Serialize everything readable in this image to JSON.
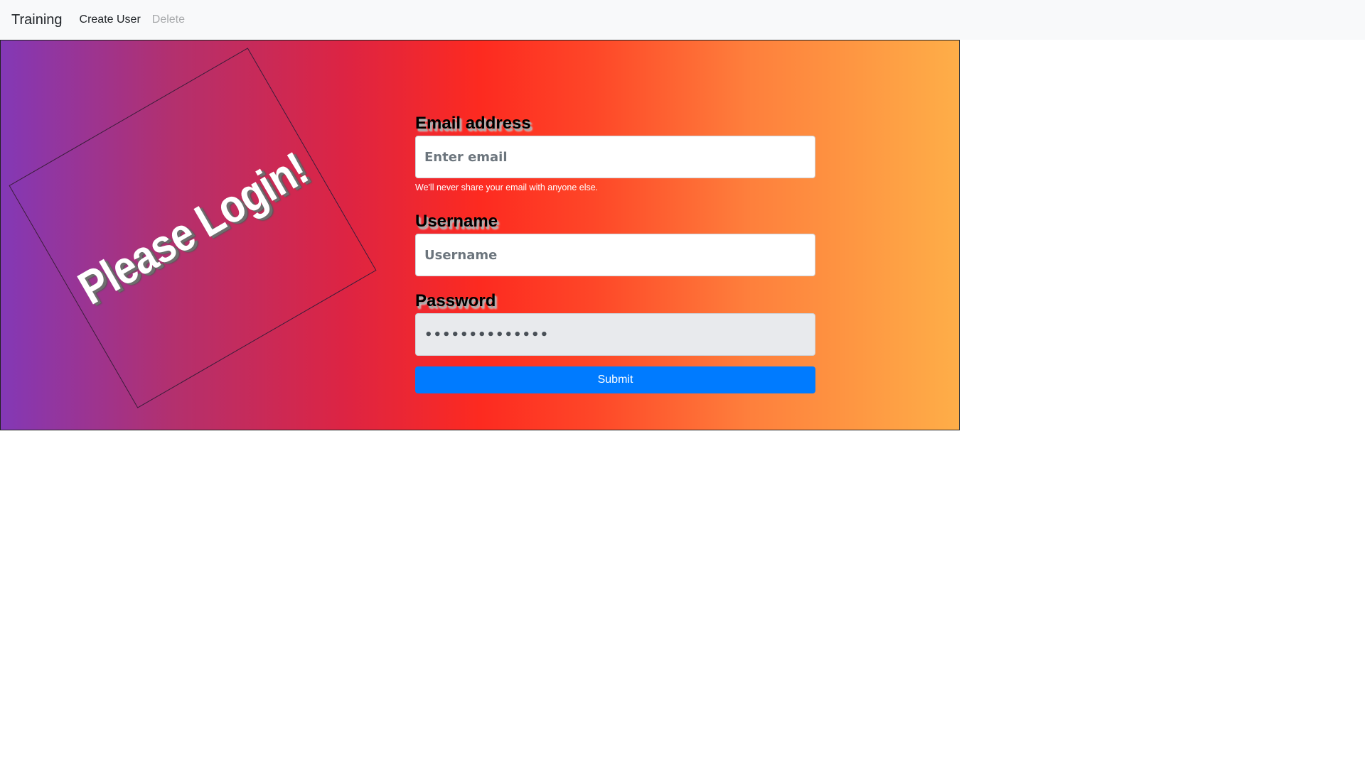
{
  "navbar": {
    "brand": "Training",
    "links": [
      {
        "label": "Create User",
        "disabled": false
      },
      {
        "label": "Delete",
        "disabled": true
      }
    ]
  },
  "banner": {
    "text": "Please Login!"
  },
  "form": {
    "email": {
      "label": "Email address",
      "placeholder": "Enter email",
      "value": "",
      "help": "We'll never share your email with anyone else."
    },
    "username": {
      "label": "Username",
      "placeholder": "Username",
      "value": ""
    },
    "password": {
      "label": "Password",
      "value": "••••••••••••••"
    },
    "submit_label": "Submit"
  },
  "colors": {
    "gradient_start": "#8338b6",
    "gradient_mid": "#fd2a20",
    "gradient_end": "#feae48",
    "submit_button": "#007bff",
    "navbar_bg": "#f8f9fa"
  }
}
